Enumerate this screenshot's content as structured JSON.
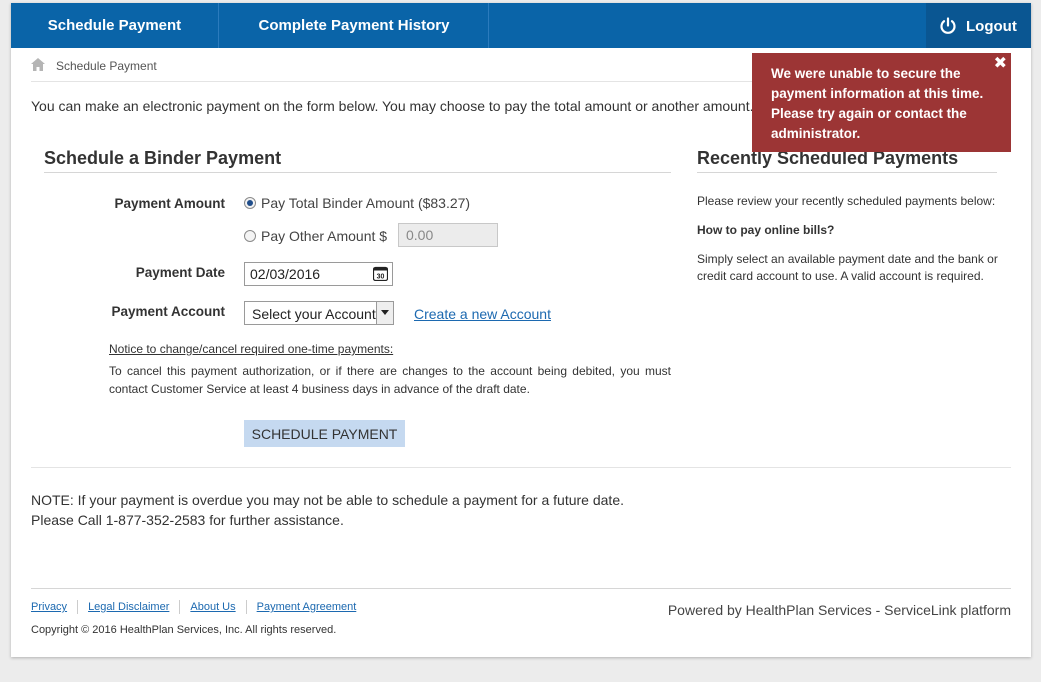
{
  "nav": {
    "tab1": "Schedule Payment",
    "tab2": "Complete Payment History",
    "logout": "Logout",
    "logout_icon": "power-icon"
  },
  "breadcrumb": {
    "home_icon": "home-icon",
    "current": "Schedule Payment"
  },
  "intro": "You can make an electronic payment on the form below. You may choose to pay the total amount or another amount.",
  "alert": {
    "message": "We were unable to secure the payment information at this time. Please try again or contact the administrator.",
    "close": "✖"
  },
  "form": {
    "title": "Schedule a Binder Payment",
    "amount_label": "Payment Amount",
    "option_total": "Pay Total Binder Amount ($83.27)",
    "option_other": "Pay Other Amount $",
    "other_amount_value": "0.00",
    "date_label": "Payment Date",
    "date_value": "02/03/2016",
    "account_label": "Payment Account",
    "account_selected": "Select your Account",
    "create_account_link": "Create a new Account",
    "notice_title": "Notice to change/cancel required one-time payments:",
    "notice_body": "To cancel this payment authorization, or if there are changes to the account being debited, you must contact Customer Service at least 4 business days in advance of the draft date.",
    "submit": "SCHEDULE PAYMENT"
  },
  "note": {
    "line1": "NOTE: If your payment is overdue you may not be able to schedule a payment for a future date.",
    "line2": "Please Call 1-877-352-2583 for further assistance."
  },
  "recent": {
    "title": "Recently Scheduled Payments",
    "review": "Please review your recently scheduled payments below:",
    "howto_title": "How to pay online bills?",
    "howto_body": "Simply select an available payment date and the bank or credit card account to use. A valid account is required."
  },
  "footer": {
    "links": [
      "Privacy",
      "Legal Disclaimer",
      "About Us",
      "Payment Agreement"
    ],
    "copyright": "Copyright © 2016 HealthPlan Services, Inc. All rights reserved.",
    "powered": "Powered by HealthPlan Services - ServiceLink platform"
  },
  "colors": {
    "nav": "#0a64a8",
    "alert": "#9c3535",
    "button": "#c5d9f0",
    "link": "#1c69b0"
  }
}
